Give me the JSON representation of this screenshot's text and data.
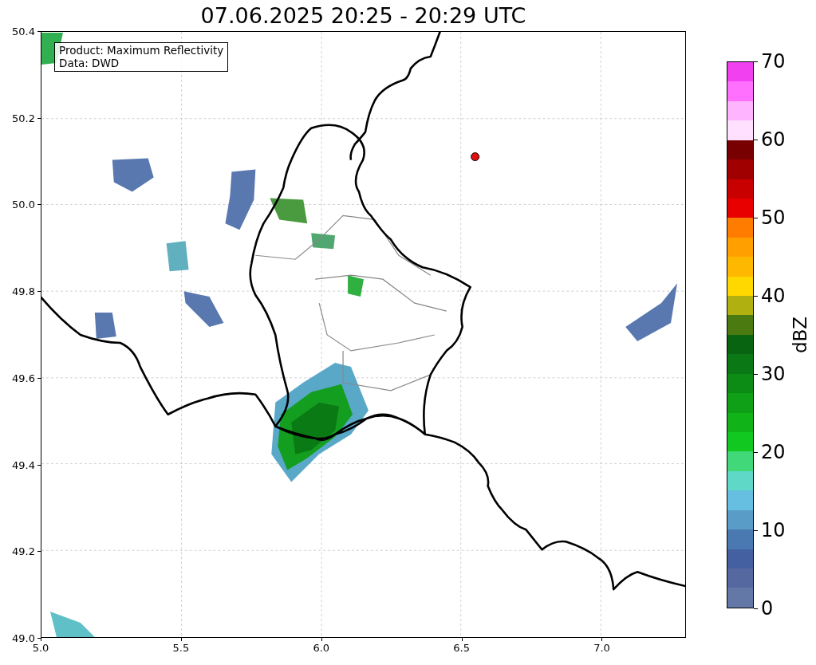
{
  "title": "07.06.2025 20:25 - 20:29 UTC",
  "map": {
    "legend": [
      "Product: Maximum Reflectivity",
      "Data: DWD"
    ],
    "x_ticks": [
      "5.0",
      "5.5",
      "6.0",
      "6.5",
      "7.0"
    ],
    "y_ticks": [
      "50.4",
      "50.2",
      "50.0",
      "49.8",
      "49.6",
      "49.4",
      "49.2",
      "49.0"
    ]
  },
  "colorbar": {
    "label": "dBZ",
    "ticks": [
      "70",
      "60",
      "50",
      "40",
      "30",
      "20",
      "10",
      "0"
    ],
    "segments": [
      {
        "color": "#f040f0"
      },
      {
        "color": "#ff70ff"
      },
      {
        "color": "#ffb4ff"
      },
      {
        "color": "#ffe0ff"
      },
      {
        "color": "#780000"
      },
      {
        "color": "#a00000"
      },
      {
        "color": "#c80000"
      },
      {
        "color": "#e80000"
      },
      {
        "color": "#ff7c00"
      },
      {
        "color": "#ffa000"
      },
      {
        "color": "#ffb800"
      },
      {
        "color": "#ffd800"
      },
      {
        "color": "#b0b010"
      },
      {
        "color": "#4a7a10"
      },
      {
        "color": "#086410"
      },
      {
        "color": "#0a7814"
      },
      {
        "color": "#0c8c14"
      },
      {
        "color": "#10a018"
      },
      {
        "color": "#10b418"
      },
      {
        "color": "#10c820"
      },
      {
        "color": "#40d878"
      },
      {
        "color": "#60d8c8"
      },
      {
        "color": "#66bee0"
      },
      {
        "color": "#5a9cc8"
      },
      {
        "color": "#4a78b0"
      },
      {
        "color": "#4560a0"
      },
      {
        "color": "#5568a0"
      },
      {
        "color": "#6478a8"
      }
    ]
  }
}
